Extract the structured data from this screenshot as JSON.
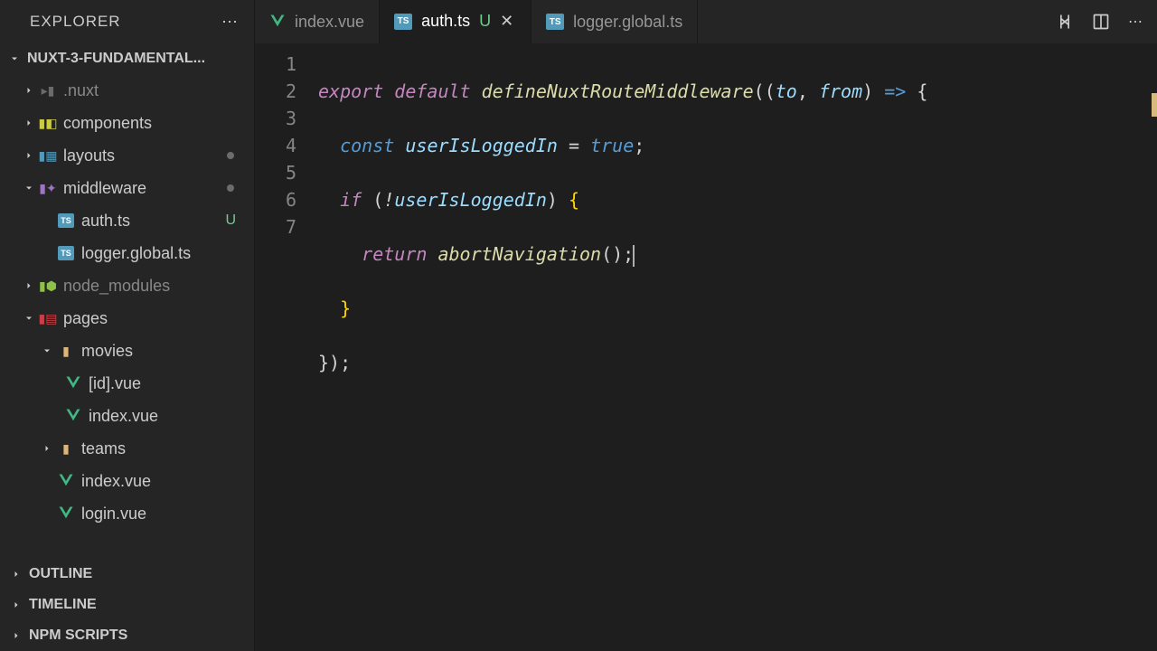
{
  "explorer": {
    "title": "EXPLORER",
    "project": "NUXT-3-FUNDAMENTAL...",
    "outline": "OUTLINE",
    "timeline": "TIMELINE",
    "npm": "NPM SCRIPTS"
  },
  "tree": {
    "nuxt": ".nuxt",
    "components": "components",
    "layouts": "layouts",
    "middleware": "middleware",
    "auth": "auth.ts",
    "auth_status": "U",
    "logger": "logger.global.ts",
    "node_modules": "node_modules",
    "pages": "pages",
    "movies": "movies",
    "id_vue": "[id].vue",
    "index_vue": "index.vue",
    "teams": "teams",
    "pages_index": "index.vue",
    "login": "login.vue"
  },
  "tabs": {
    "t1": "index.vue",
    "t2": "auth.ts",
    "t2_status": "U",
    "t3": "logger.global.ts"
  },
  "code": {
    "lines": [
      "1",
      "2",
      "3",
      "4",
      "5",
      "6",
      "7"
    ],
    "l1": {
      "export": "export",
      "default": "default",
      "fn": "defineNuxtRouteMiddleware",
      "to": "to",
      "from": "from"
    },
    "l2": {
      "const": "const",
      "var": "userIsLoggedIn",
      "true": "true"
    },
    "l3": {
      "if": "if",
      "var": "userIsLoggedIn"
    },
    "l4": {
      "return": "return",
      "fn": "abortNavigation"
    }
  }
}
